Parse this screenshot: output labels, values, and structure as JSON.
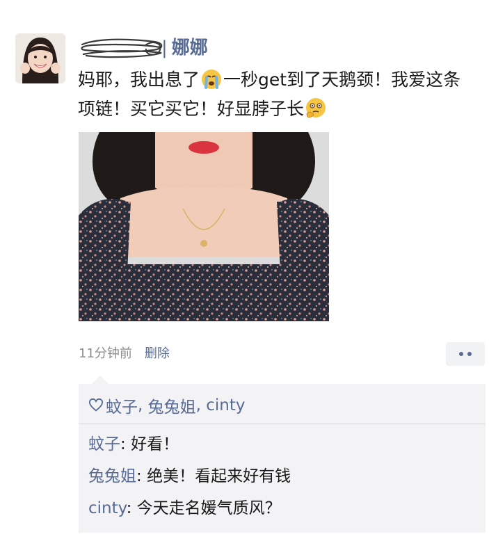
{
  "post": {
    "author_name": "娜娜",
    "name_separator": "|",
    "text_before_emoji1": "妈耶，我出息了",
    "text_between": "一秒get到了天鹅颈！我爱这条项链！买它买它！好显脖子长",
    "time": "11分钟前",
    "delete_label": "删除"
  },
  "icons": {
    "emoji1": "crying-emoji-icon",
    "emoji2": "thinking-emoji-icon",
    "heart": "heart-outline-icon",
    "more": "more-dots-icon"
  },
  "likes": {
    "users": [
      "蚊子",
      "兔兔姐",
      "cinty"
    ],
    "separator": ", "
  },
  "comments": [
    {
      "user": "蚊子",
      "text": "好看！"
    },
    {
      "user": "兔兔姐",
      "text": "绝美！看起来好有钱"
    },
    {
      "user": "cinty",
      "text": "今天走名媛气质风？"
    }
  ],
  "colors": {
    "link": "#576b95",
    "text": "#191919",
    "muted": "#8e8e8e",
    "comment_bg": "#f3f3f5"
  }
}
